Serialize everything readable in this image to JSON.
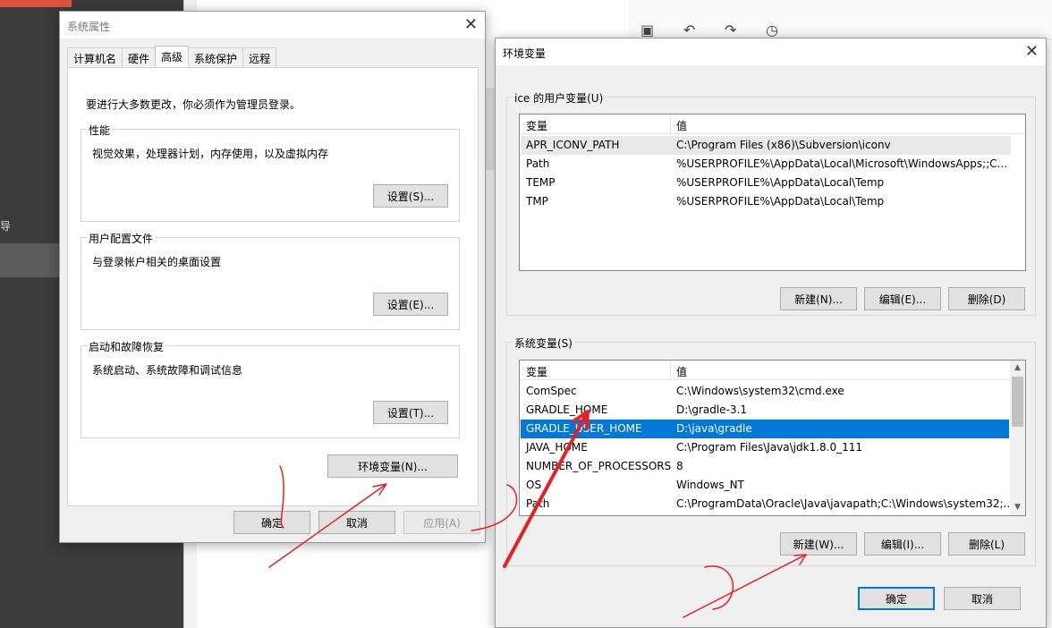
{
  "background": {
    "left_panel_char": "导"
  },
  "system_properties": {
    "title": "系统属性",
    "tabs": [
      "计算机名",
      "硬件",
      "高级",
      "系统保护",
      "远程"
    ],
    "active_tab": "高级",
    "admin_note": "要进行大多数更改，你必须作为管理员登录。",
    "performance": {
      "label": "性能",
      "desc": "视觉效果，处理器计划，内存使用，以及虚拟内存",
      "button": "设置(S)..."
    },
    "user_profiles": {
      "label": "用户配置文件",
      "desc": "与登录帐户相关的桌面设置",
      "button": "设置(E)..."
    },
    "startup_recovery": {
      "label": "启动和故障恢复",
      "desc": "系统启动、系统故障和调试信息",
      "button": "设置(T)..."
    },
    "env_button": "环境变量(N)...",
    "ok": "确定",
    "cancel": "取消",
    "apply": "应用(A)"
  },
  "environment_variables": {
    "title": "环境变量",
    "user_section_label": "ice 的用户变量(U)",
    "col_variable": "变量",
    "col_value": "值",
    "user_vars": [
      {
        "name": "APR_ICONV_PATH",
        "value": "C:\\Program Files (x86)\\Subversion\\iconv"
      },
      {
        "name": "Path",
        "value": "%USERPROFILE%\\AppData\\Local\\Microsoft\\WindowsApps;;C..."
      },
      {
        "name": "TEMP",
        "value": "%USERPROFILE%\\AppData\\Local\\Temp"
      },
      {
        "name": "TMP",
        "value": "%USERPROFILE%\\AppData\\Local\\Temp"
      }
    ],
    "user_buttons": {
      "new": "新建(N)...",
      "edit": "编辑(E)...",
      "delete": "删除(D)"
    },
    "system_section_label": "系统变量(S)",
    "system_vars": [
      {
        "name": "ComSpec",
        "value": "C:\\Windows\\system32\\cmd.exe"
      },
      {
        "name": "GRADLE_HOME",
        "value": "D:\\gradle-3.1"
      },
      {
        "name": "GRADLE_USER_HOME",
        "value": "D:\\java\\gradle"
      },
      {
        "name": "JAVA_HOME",
        "value": "C:\\Program Files\\Java\\jdk1.8.0_111"
      },
      {
        "name": "NUMBER_OF_PROCESSORS",
        "value": "8"
      },
      {
        "name": "OS",
        "value": "Windows_NT"
      },
      {
        "name": "Path",
        "value": "C:\\ProgramData\\Oracle\\Java\\javapath;C:\\Windows\\system32;..."
      }
    ],
    "selected_system_var": "GRADLE_USER_HOME",
    "system_buttons": {
      "new": "新建(W)...",
      "edit": "编辑(I)...",
      "delete": "删除(L)"
    },
    "ok": "确定",
    "cancel": "取消"
  },
  "colors": {
    "selection": "#0078d7",
    "annotation": "#e8201f"
  }
}
